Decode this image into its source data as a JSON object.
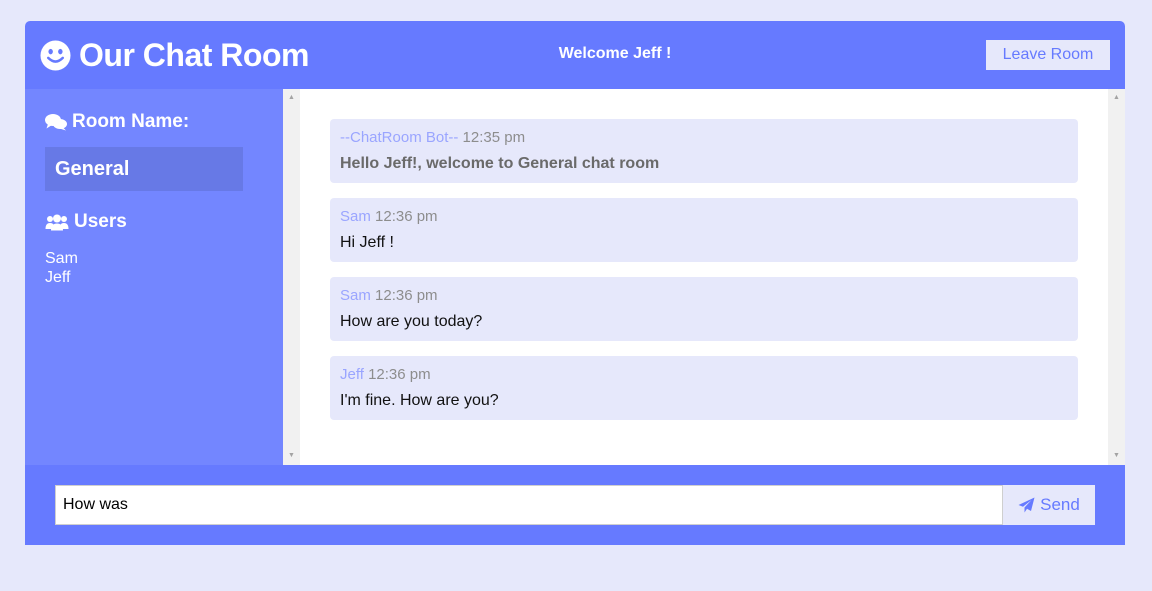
{
  "header": {
    "app_title": "Our Chat Room",
    "logo_icon": "smile-icon",
    "welcome_text": "Welcome Jeff !",
    "leave_button_label": "Leave Room"
  },
  "sidebar": {
    "room_heading": "Room Name:",
    "room_heading_icon": "comments-icon",
    "room_name": "General",
    "users_heading": "Users",
    "users_heading_icon": "users-icon",
    "users": [
      "Sam",
      "Jeff"
    ]
  },
  "messages": [
    {
      "author": "--ChatRoom Bot--",
      "time": "12:35 pm",
      "text": "Hello Jeff!, welcome to General chat room"
    },
    {
      "author": "Sam",
      "time": "12:36 pm",
      "text": "Hi Jeff !"
    },
    {
      "author": "Sam",
      "time": "12:36 pm",
      "text": "How are you today?"
    },
    {
      "author": "Jeff",
      "time": "12:36 pm",
      "text": "I'm fine. How are you?"
    }
  ],
  "composer": {
    "input_value": "How was",
    "send_button_label": "Send",
    "send_icon": "paper-plane-icon"
  },
  "colors": {
    "primary": "#667aff",
    "sidebar": "#7386ff",
    "light": "#e6e8fb",
    "author": "#9aa5ff"
  }
}
